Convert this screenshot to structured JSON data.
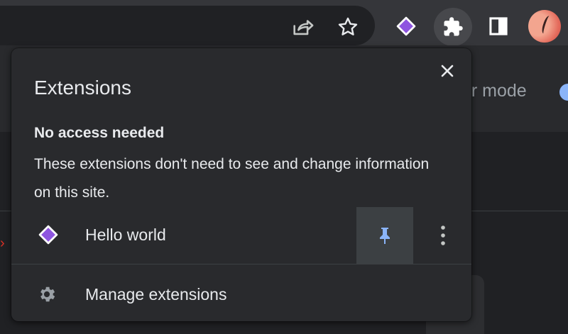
{
  "toolbar": {
    "icons": [
      "share-icon",
      "star-icon",
      "hello-world-extension-icon",
      "puzzle-icon",
      "side-panel-icon",
      "avatar"
    ]
  },
  "background_page": {
    "partial_text": "er mode"
  },
  "popup": {
    "title": "Extensions",
    "close_icon": "close-icon",
    "section": {
      "title": "No access needed",
      "description": "These extensions don't need to see and change information on this site."
    },
    "extensions": [
      {
        "name": "Hello world",
        "icon": "purple-diamond-icon",
        "pinned": true,
        "accent_color": "#8ab4f8"
      }
    ],
    "manage": {
      "label": "Manage extensions",
      "icon": "gear-icon"
    }
  },
  "colors": {
    "accent": "#8ab4f8",
    "extension_purple": "#8e55e0"
  }
}
